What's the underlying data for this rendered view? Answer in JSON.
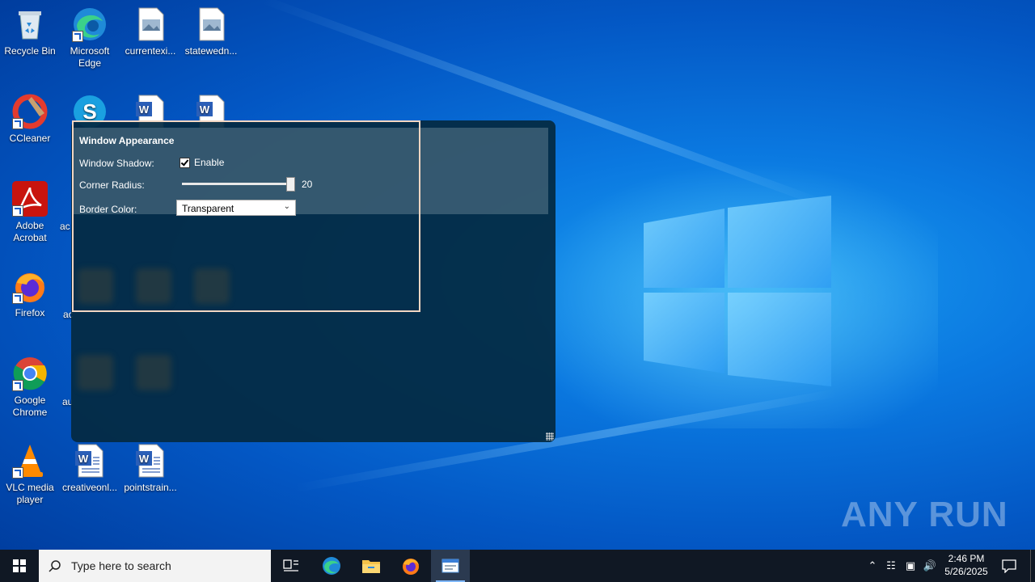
{
  "desktop": {
    "icons": [
      {
        "label": "Recycle Bin"
      },
      {
        "label": "Microsoft Edge"
      },
      {
        "label": "currentexi..."
      },
      {
        "label": "statewedn..."
      },
      {
        "label": "CCleaner"
      },
      {
        "label": "Adobe Acrobat"
      },
      {
        "label": "Firefox"
      },
      {
        "label": "Google Chrome"
      },
      {
        "label": "VLC media player"
      },
      {
        "label": "creativeonl..."
      },
      {
        "label": "pointstrain..."
      }
    ],
    "partial_labels": [
      "ac",
      "ac",
      "au"
    ]
  },
  "app": {
    "panel_title": "Window Appearance",
    "shadow_label": "Window Shadow:",
    "shadow_checked": true,
    "enable_label": "Enable",
    "radius_label": "Corner Radius:",
    "radius_value": "20",
    "radius_fraction": 1.0,
    "border_label": "Border Color:",
    "border_selected": "Transparent"
  },
  "taskbar": {
    "search_placeholder": "Type here to search",
    "time": "2:46 PM",
    "date": "5/26/2025"
  },
  "watermark": "ANY RUN",
  "colors": {
    "highlight_border": "#f2d6c2",
    "window_bg": "#042a42",
    "taskbar_bg": "#101824"
  }
}
